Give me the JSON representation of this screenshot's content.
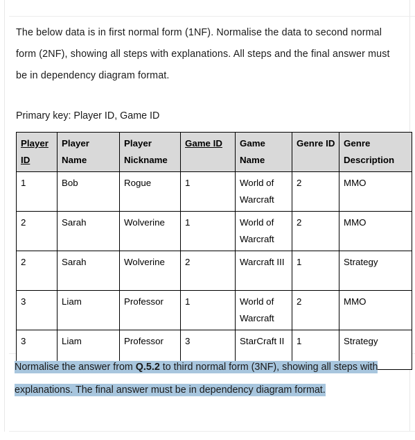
{
  "document": {
    "intro_paragraph": "The below data is in first normal form (1NF). Normalise the data to second normal form (2NF), showing all steps with explanations. All steps and the final answer must be in dependency diagram format.",
    "primary_key_line": "Primary key: Player ID, Game ID",
    "table": {
      "headers": [
        {
          "label": "Player ID",
          "underlined": true
        },
        {
          "label": "Player Name",
          "underlined": false
        },
        {
          "label": "Player Nickname",
          "underlined": false
        },
        {
          "label": "Game ID",
          "underlined": true
        },
        {
          "label": "Game Name",
          "underlined": false
        },
        {
          "label": "Genre ID",
          "underlined": false
        },
        {
          "label": "Genre Description",
          "underlined": false
        }
      ],
      "rows": [
        [
          "1",
          "Bob",
          "Rogue",
          "1",
          "World of Warcraft",
          "2",
          "MMO"
        ],
        [
          "2",
          "Sarah",
          "Wolverine",
          "1",
          "World of Warcraft",
          "2",
          "MMO"
        ],
        [
          "2",
          "Sarah",
          "Wolverine",
          "2",
          "Warcraft III",
          "1",
          "Strategy"
        ],
        [
          "3",
          "Liam",
          "Professor",
          "1",
          "World of Warcraft",
          "2",
          "MMO"
        ],
        [
          "3",
          "Liam",
          "Professor",
          "3",
          "StarCraft II",
          "1",
          "Strategy"
        ]
      ]
    },
    "question_highlighted": {
      "part1": "Normalise the answer from ",
      "bold_reference": "Q.5.2",
      "part2": " to third normal form (3NF), showing all steps with explanations. The final answer must be in dependency diagram format. "
    }
  },
  "colors": {
    "header_background": "#d9d9d9",
    "highlight": "#a8c6de",
    "table_border": "#000000",
    "page_edge": "#e8e8e8",
    "text": "#1a1a1a"
  }
}
